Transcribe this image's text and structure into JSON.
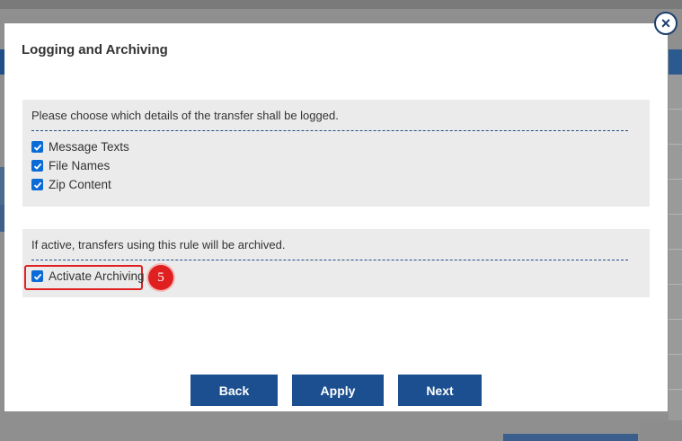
{
  "dialog": {
    "title": "Logging and Archiving",
    "close_label": "×",
    "logging": {
      "description": "Please choose which details of the transfer shall be logged.",
      "options": [
        {
          "label": "Message Texts",
          "checked": true
        },
        {
          "label": "File Names",
          "checked": true
        },
        {
          "label": "Zip Content",
          "checked": true
        }
      ]
    },
    "archiving": {
      "description": "If active, transfers using this rule will be archived.",
      "option": {
        "label": "Activate Archiving",
        "checked": true
      },
      "step_badge": "5"
    },
    "buttons": {
      "back": "Back",
      "apply": "Apply",
      "next": "Next"
    }
  },
  "colors": {
    "accent": "#1b4f8f",
    "checkbox": "#0b6bd6",
    "highlight": "#e02020"
  }
}
